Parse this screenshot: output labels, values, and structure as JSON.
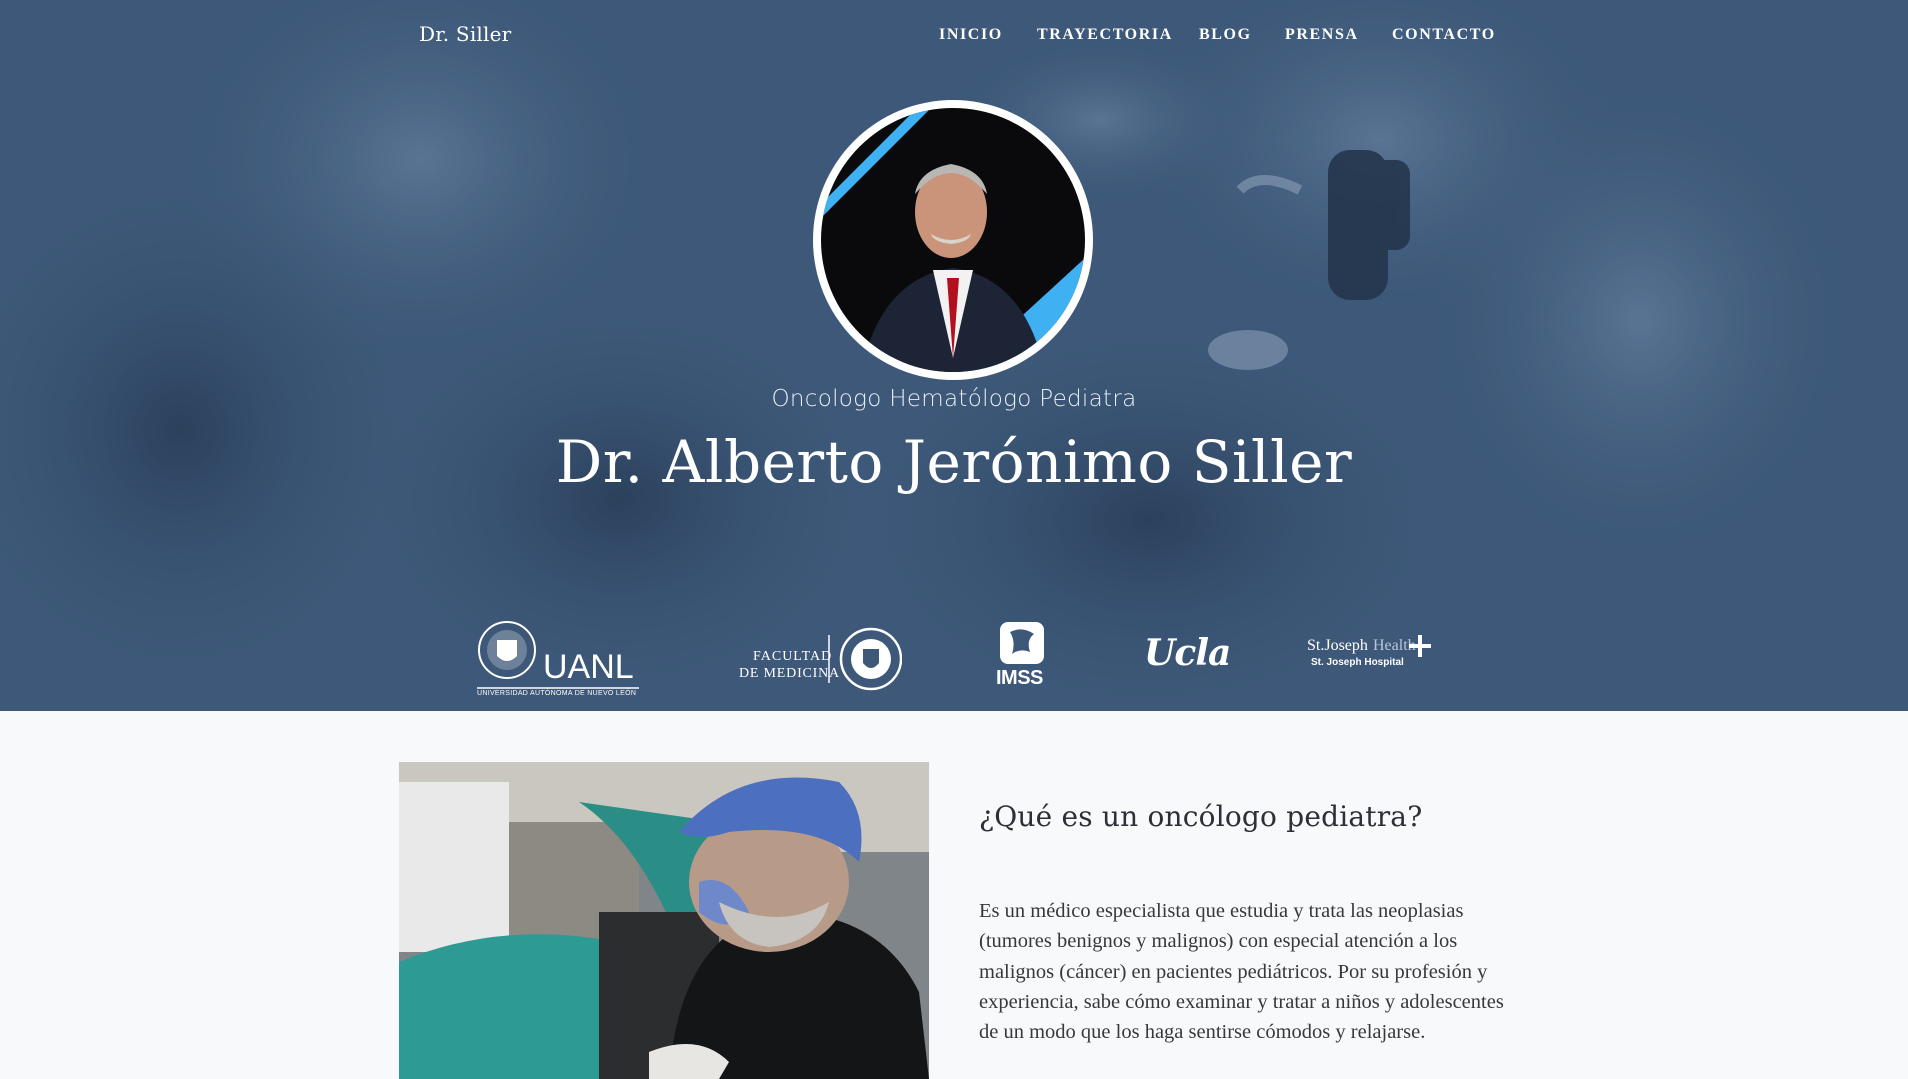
{
  "brand": "Dr. Siller",
  "nav": {
    "items": [
      "INICIO",
      "TRAYECTORIA",
      "BLOG",
      "PRENSA",
      "CONTACTO"
    ]
  },
  "hero": {
    "subtitle": "Oncologo Hematólogo Pediatra",
    "name": "Dr. Alberto Jerónimo Siller",
    "overlay_color": "#3d5878"
  },
  "logos": {
    "uanl": {
      "title": "UANL",
      "caption": "UNIVERSIDAD AUTÓNOMA DE NUEVO LEÓN"
    },
    "facultad": {
      "line1": "FACULTAD",
      "line2": "DE MEDICINA"
    },
    "imss": {
      "title": "IMSS"
    },
    "ucla": {
      "title": "Ucla"
    },
    "stjoseph": {
      "line1a": "St.Joseph",
      "line1b": "Health",
      "line2": "St. Joseph Hospital"
    }
  },
  "article": {
    "heading": "¿Qué es un oncólogo pediatra?",
    "body": "Es un médico especialista que estudia y trata las neoplasias (tumores benignos y malignos) con especial atención a los malignos (cáncer) en pacientes pediátricos. Por su profesión y experiencia, sabe cómo examinar y tratar a niños y adolescentes de un modo que los haga sentirse cómodos y relajarse."
  },
  "colors": {
    "accent_blue": "#3fb0f2",
    "page_bg": "#f7f9fb",
    "text_dark": "#2c2f35"
  }
}
